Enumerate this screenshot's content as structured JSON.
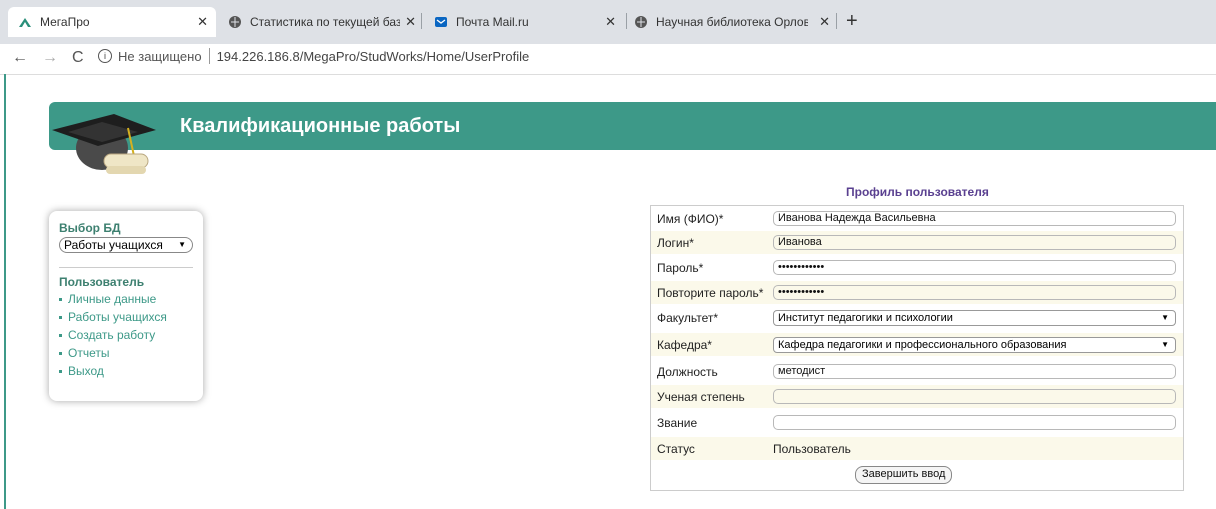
{
  "browser": {
    "tabs": [
      {
        "title": "МегаПро"
      },
      {
        "title": "Статистика по текущей базе дан"
      },
      {
        "title": "Почта Mail.ru"
      },
      {
        "title": "Научная библиотека Орловского"
      }
    ],
    "security": "Не защищено",
    "url": "194.226.186.8/MegaPro/StudWorks/Home/UserProfile"
  },
  "header": {
    "title": "Квалификационные работы"
  },
  "sidebar": {
    "db_heading": "Выбор БД",
    "db_selected": "Работы учащихся",
    "user_heading": "Пользователь",
    "items": [
      {
        "label": "Личные данные"
      },
      {
        "label": "Работы учащихся"
      },
      {
        "label": "Создать работу"
      },
      {
        "label": "Отчеты"
      },
      {
        "label": "Выход"
      }
    ]
  },
  "profile": {
    "title": "Профиль пользователя",
    "fields": {
      "name": {
        "label": "Имя (ФИО)*",
        "value": "Иванова Надежда Васильевна"
      },
      "login": {
        "label": "Логин*",
        "value": "Иванова"
      },
      "password": {
        "label": "Пароль*",
        "value": "••••••••••••"
      },
      "password_repeat": {
        "label": "Повторите пароль*",
        "value": "••••••••••••"
      },
      "faculty": {
        "label": "Факультет*",
        "value": "Институт педагогики и психологии"
      },
      "department": {
        "label": "Кафедра*",
        "value": "Кафедра педагогики и профессионального образования"
      },
      "position": {
        "label": "Должность",
        "value": "методист"
      },
      "degree": {
        "label": "Ученая степень",
        "value": ""
      },
      "rank": {
        "label": "Звание",
        "value": ""
      },
      "status": {
        "label": "Статус",
        "value": "Пользователь"
      }
    },
    "submit_label": "Завершить ввод"
  },
  "colors": {
    "accent": "#3d9988",
    "profile_title": "#5a4090",
    "alt_row": "#fbf9ea"
  }
}
